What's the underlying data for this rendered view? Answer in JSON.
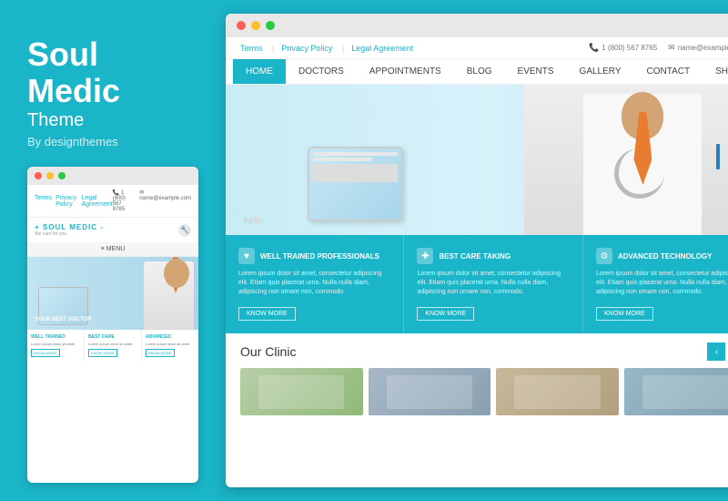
{
  "left": {
    "brand": {
      "title": "Soul",
      "title_line2": "Medic",
      "subtitle": "Theme",
      "byline": "By designthemes"
    },
    "mini_browser": {
      "topbar_links": [
        "Terms",
        "Privacy Policy",
        "Legal Agreement"
      ],
      "phone": "1 (800) 567 8765",
      "email": "name@example.com",
      "logo": "+ SOUL MEDIC -",
      "tagline": "We care for you",
      "menu_label": "MENU",
      "hero_text": "YOUR BEST DOCTOR",
      "features": [
        {
          "title": "WELL TRAINED",
          "text": "Lorem ipsum dolor",
          "btn": "KNOW MORE"
        },
        {
          "title": "BEST CARE",
          "text": "Lorem ipsum dolor",
          "btn": "KNOW MORE"
        },
        {
          "title": "ADVANCED",
          "text": "Lorem ipsum dolor",
          "btn": "KNOW MORE"
        }
      ]
    }
  },
  "right": {
    "browser": {
      "topbar_links": [
        "Terms",
        "Privacy Policy",
        "Legal Agreement"
      ],
      "phone": "1 (800) 567 8765",
      "email": "name@example.com",
      "nav_items": [
        "HOME",
        "DOCTORS",
        "APPOINTMENTS",
        "BLOG",
        "EVENTS",
        "GALLERY",
        "CONTACT",
        "SHOP"
      ],
      "active_nav": "HOME",
      "hero_subtext": "hello",
      "features": [
        {
          "icon": "♥",
          "title": "WELL TRAINED PROFESSIONALS",
          "text": "Lorem ipsum dolor sit amet, consectetur adipiscing elit. Etiam quis placerat urna. Nulla nulla diam, adipiscing non ornare non, commodo.",
          "btn": "KNOW MORE"
        },
        {
          "icon": "✚",
          "title": "BEST CARE TAKING",
          "text": "Lorem ipsum dolor sit amet, consectetur adipiscing elit. Etiam quis placerat urna. Nulla nulla diam, adipiscing non ornare non, commodo.",
          "btn": "KNOW MORE"
        },
        {
          "icon": "⚙",
          "title": "ADVANCED TECHNOLOGY",
          "text": "Lorem ipsum dolor sit amet, consectetur adipiscing elit. Etiam quis placerat urna. Nulla nulla diam, adipiscing non ornare non, commodo.",
          "btn": "KNOW MORE"
        }
      ],
      "clinic_title": "Our Clinic"
    }
  },
  "colors": {
    "primary": "#1ab5c8",
    "white": "#ffffff",
    "dark": "#333333"
  }
}
